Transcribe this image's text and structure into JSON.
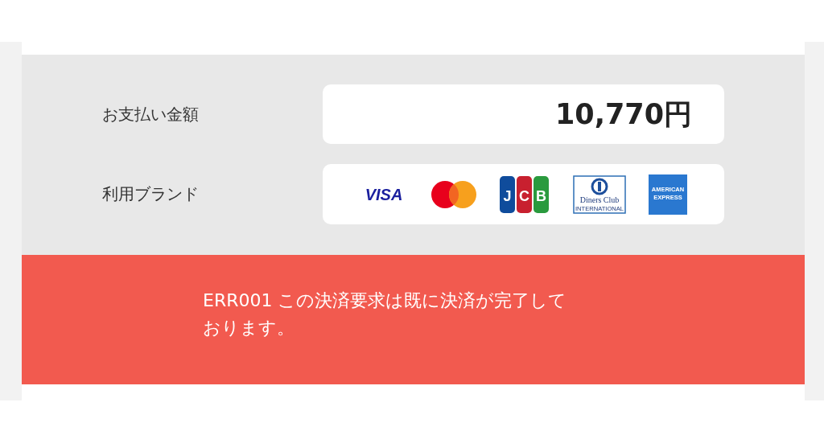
{
  "payment": {
    "amount_label": "お支払い金額",
    "amount": "10,770円",
    "brands_label": "利用ブランド",
    "brands": [
      {
        "kind": "visa",
        "texts": [
          "VISA"
        ]
      },
      {
        "kind": "mastercard"
      },
      {
        "kind": "jcb",
        "texts": [
          "J",
          "C",
          "B"
        ]
      },
      {
        "kind": "diners",
        "texts": [
          "Diners Club",
          "INTERNATIONAL"
        ]
      },
      {
        "kind": "amex",
        "texts": [
          "AMERICAN",
          "EXPRESS"
        ]
      }
    ]
  },
  "error": {
    "message": "ERR001 この決済要求は既に決済が完了しております。"
  }
}
